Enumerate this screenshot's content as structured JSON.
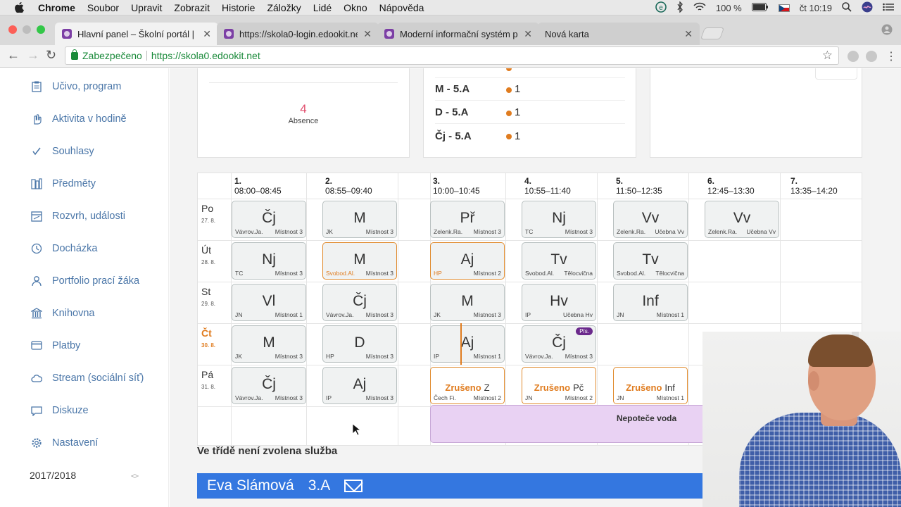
{
  "menubar": {
    "app": "Chrome",
    "items": [
      "Soubor",
      "Upravit",
      "Zobrazit",
      "Historie",
      "Záložky",
      "Lidé",
      "Okno",
      "Nápověda"
    ],
    "battery": "100 %",
    "clock": "čt 10:19"
  },
  "tabs": [
    {
      "label": "Hlavní panel – Školní portál | e",
      "active": true
    },
    {
      "label": "https://skola0-login.edookit.ne",
      "active": false
    },
    {
      "label": "Moderní informační systém pro",
      "active": false
    },
    {
      "label": "Nová karta",
      "active": false
    }
  ],
  "address": {
    "secure_label": "Zabezpečeno",
    "url": "https://skola0.edookit.net"
  },
  "sidebar": {
    "items": [
      {
        "label": "Učivo, program",
        "icon": "clipboard-icon"
      },
      {
        "label": "Aktivita v hodině",
        "icon": "hand-icon"
      },
      {
        "label": "Souhlasy",
        "icon": "check-icon"
      },
      {
        "label": "Předměty",
        "icon": "books-icon"
      },
      {
        "label": "Rozvrh, události",
        "icon": "calendar-icon"
      },
      {
        "label": "Docházka",
        "icon": "clock-icon"
      },
      {
        "label": "Portfolio prací žáka",
        "icon": "person-icon"
      },
      {
        "label": "Knihovna",
        "icon": "library-icon"
      },
      {
        "label": "Platby",
        "icon": "card-icon"
      },
      {
        "label": "Stream (sociální síť)",
        "icon": "cloud-icon"
      },
      {
        "label": "Diskuze",
        "icon": "chat-icon"
      },
      {
        "label": "Nastavení",
        "icon": "gear-icon"
      }
    ],
    "year": "2017/2018"
  },
  "absence": {
    "count": "4",
    "label": "Absence"
  },
  "marks": [
    {
      "subject": "M - 5.A",
      "count": "1"
    },
    {
      "subject": "D - 5.A",
      "count": "1"
    },
    {
      "subject": "Čj - 5.A",
      "count": "1"
    }
  ],
  "timetable": {
    "periods": [
      {
        "num": "1.",
        "time": "08:00–08:45"
      },
      {
        "num": "2.",
        "time": "08:55–09:40"
      },
      {
        "num": "3.",
        "time": "10:00–10:45"
      },
      {
        "num": "4.",
        "time": "10:55–11:40"
      },
      {
        "num": "5.",
        "time": "11:50–12:35"
      },
      {
        "num": "6.",
        "time": "12:45–13:30"
      },
      {
        "num": "7.",
        "time": "13:35–14:20"
      }
    ],
    "days": [
      {
        "name": "Po",
        "date": "27. 8.",
        "today": false
      },
      {
        "name": "Út",
        "date": "28. 8.",
        "today": false
      },
      {
        "name": "St",
        "date": "29. 8.",
        "today": false
      },
      {
        "name": "Čt",
        "date": "30. 8.",
        "today": true
      },
      {
        "name": "Pá",
        "date": "31. 8.",
        "today": false
      }
    ],
    "lessons": [
      {
        "day": 0,
        "col": 0,
        "subject": "Čj",
        "teacher": "Vávrov.Ja.",
        "room": "Místnost 3"
      },
      {
        "day": 0,
        "col": 1,
        "subject": "M",
        "teacher": "JK",
        "room": "Místnost 3"
      },
      {
        "day": 0,
        "col": 2,
        "subject": "Př",
        "teacher": "Zelenk.Ra.",
        "room": "Místnost 3"
      },
      {
        "day": 0,
        "col": 3,
        "subject": "Nj",
        "teacher": "TC",
        "room": "Místnost 3"
      },
      {
        "day": 0,
        "col": 4,
        "subject": "Vv",
        "teacher": "Zelenk.Ra.",
        "room": "Učebna Vv"
      },
      {
        "day": 0,
        "col": 5,
        "subject": "Vv",
        "teacher": "Zelenk.Ra.",
        "room": "Učebna Vv"
      },
      {
        "day": 1,
        "col": 0,
        "subject": "Nj",
        "teacher": "TC",
        "room": "Místnost 3"
      },
      {
        "day": 1,
        "col": 1,
        "subject": "M",
        "teacher": "Svobod.Al.",
        "room": "Místnost 3",
        "substitute": true
      },
      {
        "day": 1,
        "col": 2,
        "subject": "Aj",
        "teacher": "HP",
        "room": "Místnost 2",
        "substitute": true
      },
      {
        "day": 1,
        "col": 3,
        "subject": "Tv",
        "teacher": "Svobod.Al.",
        "room": "Tělocvična"
      },
      {
        "day": 1,
        "col": 4,
        "subject": "Tv",
        "teacher": "Svobod.Al.",
        "room": "Tělocvična"
      },
      {
        "day": 2,
        "col": 0,
        "subject": "Vl",
        "teacher": "JN",
        "room": "Místnost 1"
      },
      {
        "day": 2,
        "col": 1,
        "subject": "Čj",
        "teacher": "Vávrov.Ja.",
        "room": "Místnost 3"
      },
      {
        "day": 2,
        "col": 2,
        "subject": "M",
        "teacher": "JK",
        "room": "Místnost 3"
      },
      {
        "day": 2,
        "col": 3,
        "subject": "Hv",
        "teacher": "IP",
        "room": "Učebna Hv"
      },
      {
        "day": 2,
        "col": 4,
        "subject": "Inf",
        "teacher": "JN",
        "room": "Místnost 1"
      },
      {
        "day": 3,
        "col": 0,
        "subject": "M",
        "teacher": "JK",
        "room": "Místnost 3"
      },
      {
        "day": 3,
        "col": 1,
        "subject": "D",
        "teacher": "HP",
        "room": "Místnost 3"
      },
      {
        "day": 3,
        "col": 2,
        "subject": "Aj",
        "teacher": "IP",
        "room": "Místnost 1"
      },
      {
        "day": 3,
        "col": 3,
        "subject": "Čj",
        "teacher": "Vávrov.Ja.",
        "room": "Místnost 3",
        "badge": "Pís."
      },
      {
        "day": 4,
        "col": 0,
        "subject": "Čj",
        "teacher": "Vávrov.Ja.",
        "room": "Místnost 3"
      },
      {
        "day": 4,
        "col": 1,
        "subject": "Aj",
        "teacher": "IP",
        "room": "Místnost 3"
      },
      {
        "day": 4,
        "col": 2,
        "subject": "Z",
        "teacher": "Čech Fi.",
        "room": "Místnost 2",
        "cancelled": "Zrušeno"
      },
      {
        "day": 4,
        "col": 3,
        "subject": "Pč",
        "teacher": "JN",
        "room": "Místnost 2",
        "cancelled": "Zrušeno"
      },
      {
        "day": 4,
        "col": 4,
        "subject": "Inf",
        "teacher": "JN",
        "room": "Místnost 1",
        "cancelled": "Zrušeno"
      }
    ],
    "event": "Nepoteče voda"
  },
  "duty": "Ve třídě není zvolena služba",
  "student": {
    "name": "Eva Slámová",
    "class": "3.A"
  },
  "colors": {
    "accent": "#3477e0",
    "orange": "#e07c1f",
    "link": "#4a76a8"
  }
}
